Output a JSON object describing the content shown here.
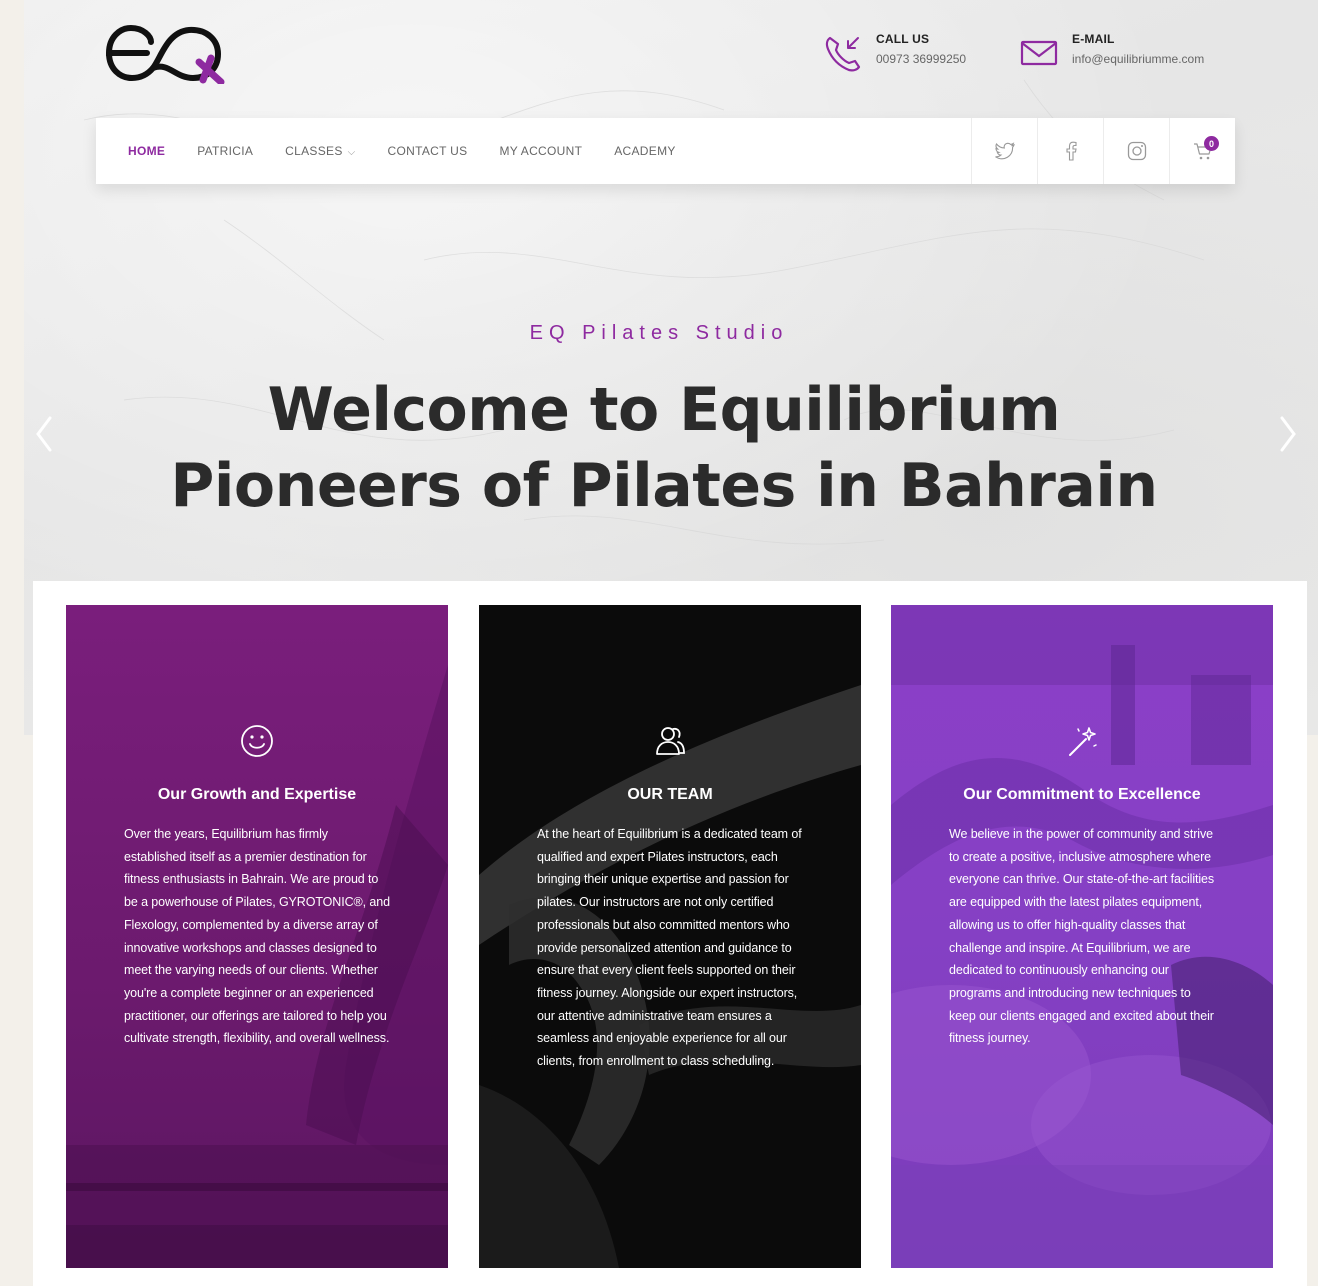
{
  "header": {
    "logo_text": "eQ",
    "call_label": "CALL US",
    "call_value": "00973 36999250",
    "email_label": "E-MAIL",
    "email_value": "info@equilibriumme.com"
  },
  "nav": {
    "items": [
      {
        "label": "HOME",
        "active": true
      },
      {
        "label": "PATRICIA"
      },
      {
        "label": "CLASSES",
        "has_dropdown": true
      },
      {
        "label": "CONTACT US"
      },
      {
        "label": "MY ACCOUNT"
      },
      {
        "label": "ACADEMY"
      }
    ],
    "social": [
      "twitter-icon",
      "facebook-icon",
      "instagram-icon",
      "cart-icon"
    ],
    "cart_count": "0"
  },
  "hero": {
    "subtitle": "EQ Pilates Studio",
    "headline_line1": "Welcome to Equilibrium",
    "headline_line2": "Pioneers of Pilates in Bahrain"
  },
  "cards": [
    {
      "icon": "smiley-icon",
      "title": "Our Growth and Expertise",
      "body": "Over the years, Equilibrium has firmly established itself as a premier destination for fitness enthusiasts in Bahrain. We are proud to be a powerhouse of Pilates, GYROTONIC®, and Flexology, complemented by a diverse array of innovative workshops and classes designed to meet the varying needs of our clients. Whether you're a complete beginner or an experienced practitioner, our offerings are tailored to help you cultivate strength, flexibility, and overall wellness."
    },
    {
      "icon": "team-icon",
      "title": "OUR TEAM",
      "body": "At the heart of Equilibrium is a dedicated team of qualified and expert Pilates instructors, each bringing their unique expertise and passion for pilates. Our instructors are not only certified professionals but also committed mentors who provide personalized attention and guidance to ensure that every client feels supported on their fitness journey. Alongside our expert instructors, our attentive administrative team ensures a seamless and enjoyable experience for all our clients, from enrollment to class scheduling."
    },
    {
      "icon": "magic-wand-icon",
      "title": "Our Commitment to Excellence",
      "body": "We believe in the power of community and strive to create a positive, inclusive atmosphere where everyone can thrive. Our state-of-the-art facilities are equipped with the latest pilates equipment, allowing us to offer high-quality classes that challenge and inspire. At Equilibrium, we are dedicated to continuously enhancing our programs and introducing new techniques to keep our clients engaged and excited about their fitness journey."
    }
  ],
  "colors": {
    "accent": "#8e2aa0",
    "card1": "#6e1b70",
    "card2": "#0b0b0b",
    "card3": "#8540c4",
    "headline": "#2b2b2b"
  }
}
